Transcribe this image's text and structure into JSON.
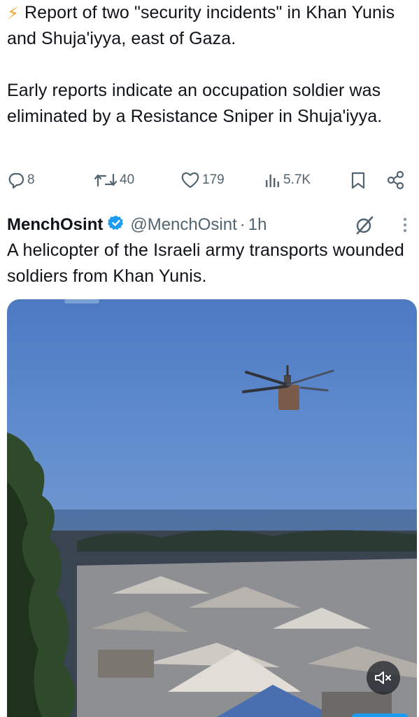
{
  "tweet1": {
    "line1": "Report of two \"security incidents\" in Khan Yunis and Shuja'iyya, east of Gaza.",
    "line2": "Early reports indicate an occupation soldier was eliminated by a Resistance Sniper in Shuja'iyya."
  },
  "actions": {
    "replies": "8",
    "reposts": "40",
    "likes": "179",
    "views": "5.7K"
  },
  "tweet2": {
    "display_name": "MenchOsint",
    "handle": "@MenchOsint",
    "separator": "·",
    "time": "1h",
    "text": "A helicopter of the Israeli army transports wounded soldiers from Khan Yunis."
  },
  "colors": {
    "accent": "#1d9bf0",
    "muted": "#536471",
    "text": "#0f1419"
  },
  "icons": {
    "lightning": "high-voltage-icon",
    "reply": "reply-icon",
    "repost": "repost-icon",
    "like": "heart-icon",
    "views": "analytics-icon",
    "bookmark": "bookmark-icon",
    "share": "share-icon",
    "verified": "verified-badge-icon",
    "grok": "grok-icon",
    "more": "more-options-icon",
    "mute": "muted-speaker-icon"
  }
}
